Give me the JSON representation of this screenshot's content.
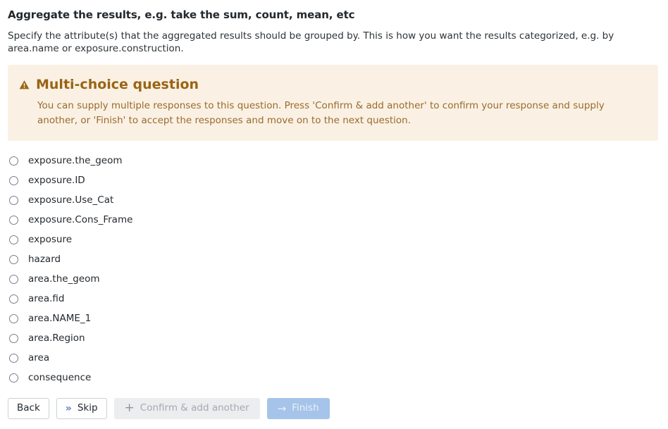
{
  "question": {
    "title": "Aggregate the results, e.g. take the sum, count, mean, etc",
    "description": "Specify the attribute(s) that the aggregated results should be grouped by. This is how you want the results categorized, e.g. by area.name or exposure.construction."
  },
  "alert": {
    "icon": "warning-triangle-icon",
    "heading": "Multi-choice question",
    "body": "You can supply multiple responses to this question. Press 'Confirm & add another' to confirm your response and supply another, or 'Finish' to accept the responses and move on to the next question.",
    "background_color": "#faf1e4",
    "heading_color": "#9a6414",
    "text_color": "#9a6a2e"
  },
  "choices": [
    {
      "label": "exposure.the_geom",
      "selected": false
    },
    {
      "label": "exposure.ID",
      "selected": false
    },
    {
      "label": "exposure.Use_Cat",
      "selected": false
    },
    {
      "label": "exposure.Cons_Frame",
      "selected": false
    },
    {
      "label": "exposure",
      "selected": false
    },
    {
      "label": "hazard",
      "selected": false
    },
    {
      "label": "area.the_geom",
      "selected": false
    },
    {
      "label": "area.fid",
      "selected": false
    },
    {
      "label": "area.NAME_1",
      "selected": false
    },
    {
      "label": "area.Region",
      "selected": false
    },
    {
      "label": "area",
      "selected": false
    },
    {
      "label": "consequence",
      "selected": false
    }
  ],
  "buttons": {
    "back": {
      "label": "Back",
      "enabled": true
    },
    "skip": {
      "label": "Skip",
      "icon": "double-chevron-right-icon",
      "enabled": true
    },
    "confirm_add_another": {
      "label": "Confirm & add another",
      "icon": "plus-icon",
      "enabled": false,
      "background_color": "#ebedef",
      "text_color": "#a4aab1"
    },
    "finish": {
      "label": "Finish",
      "icon": "arrow-right-icon",
      "enabled": false,
      "background_color": "#a6c4e9",
      "text_color": "#e9f0f9"
    }
  }
}
